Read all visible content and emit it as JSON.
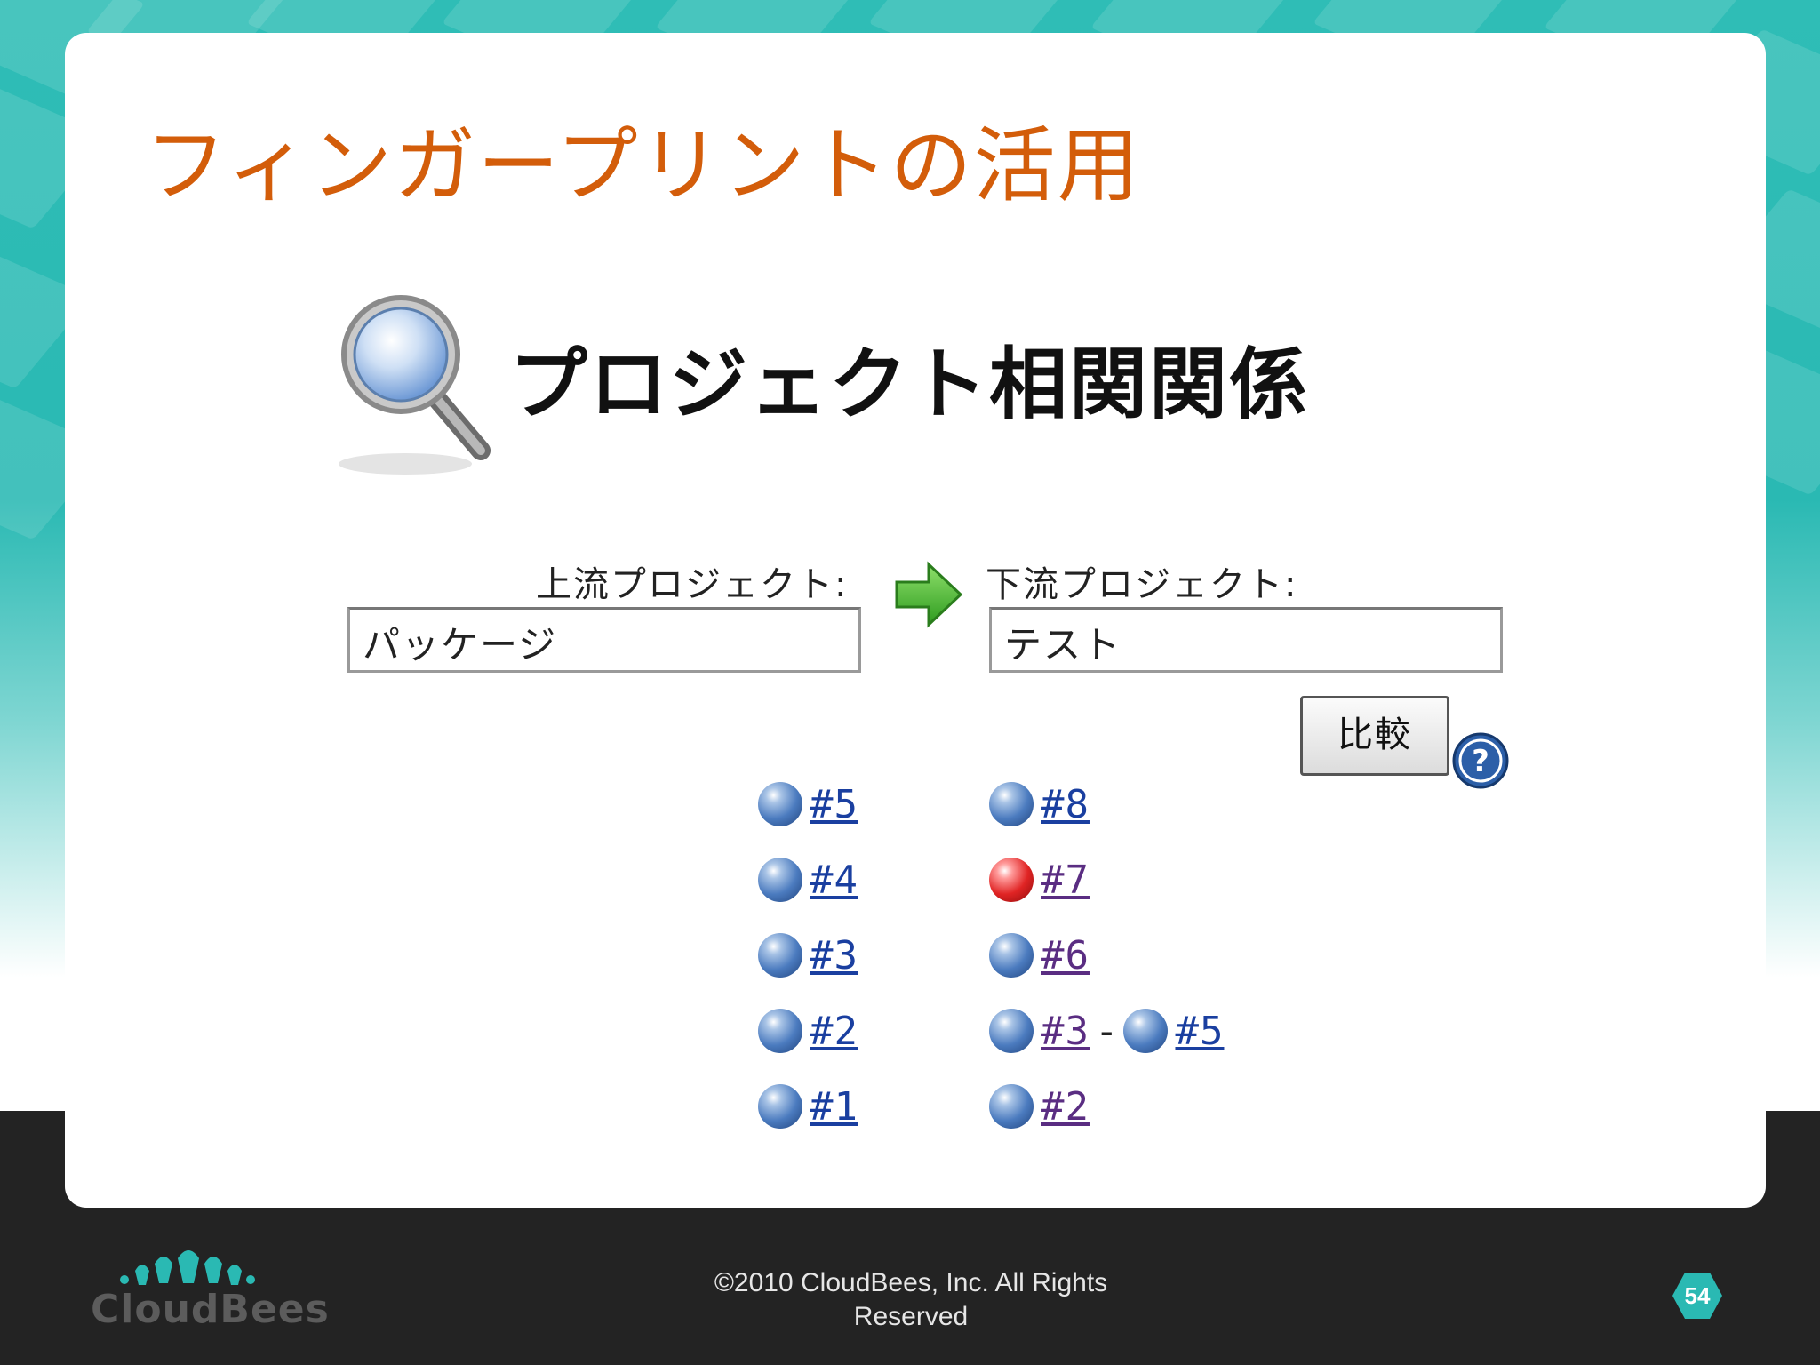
{
  "slide": {
    "title": "フィンガープリントの活用"
  },
  "screenshot": {
    "heading": "プロジェクト相関関係",
    "upstream_label": "上流プロジェクト:",
    "downstream_label": "下流プロジェクト:",
    "upstream_value": "パッケージ",
    "downstream_value": "テスト",
    "compare_button": "比較",
    "upstream_builds": [
      {
        "label": "#5",
        "status": "blue"
      },
      {
        "label": "#4",
        "status": "blue"
      },
      {
        "label": "#3",
        "status": "blue"
      },
      {
        "label": "#2",
        "status": "blue"
      },
      {
        "label": "#1",
        "status": "blue"
      }
    ],
    "downstream_builds": [
      {
        "label": "#8",
        "status": "blue"
      },
      {
        "label": "#7",
        "status": "red"
      },
      {
        "label": "#6",
        "status": "blue"
      },
      {
        "label": "#3",
        "status": "blue",
        "range_end": "#5"
      },
      {
        "label": "#2",
        "status": "blue"
      }
    ]
  },
  "footer": {
    "logo_text": "CloudBees",
    "copyright": "©2010 CloudBees, Inc. All Rights Reserved",
    "page_number": "54"
  },
  "colors": {
    "title": "#d35d0a",
    "teal": "#2ab9b3",
    "footer_bg": "#232323",
    "link": "#1a3fa0"
  },
  "icons": [
    "magnifier-icon",
    "right-arrow-icon",
    "help-icon",
    "build-status-ball-icon",
    "cloudbees-logo-icon"
  ]
}
